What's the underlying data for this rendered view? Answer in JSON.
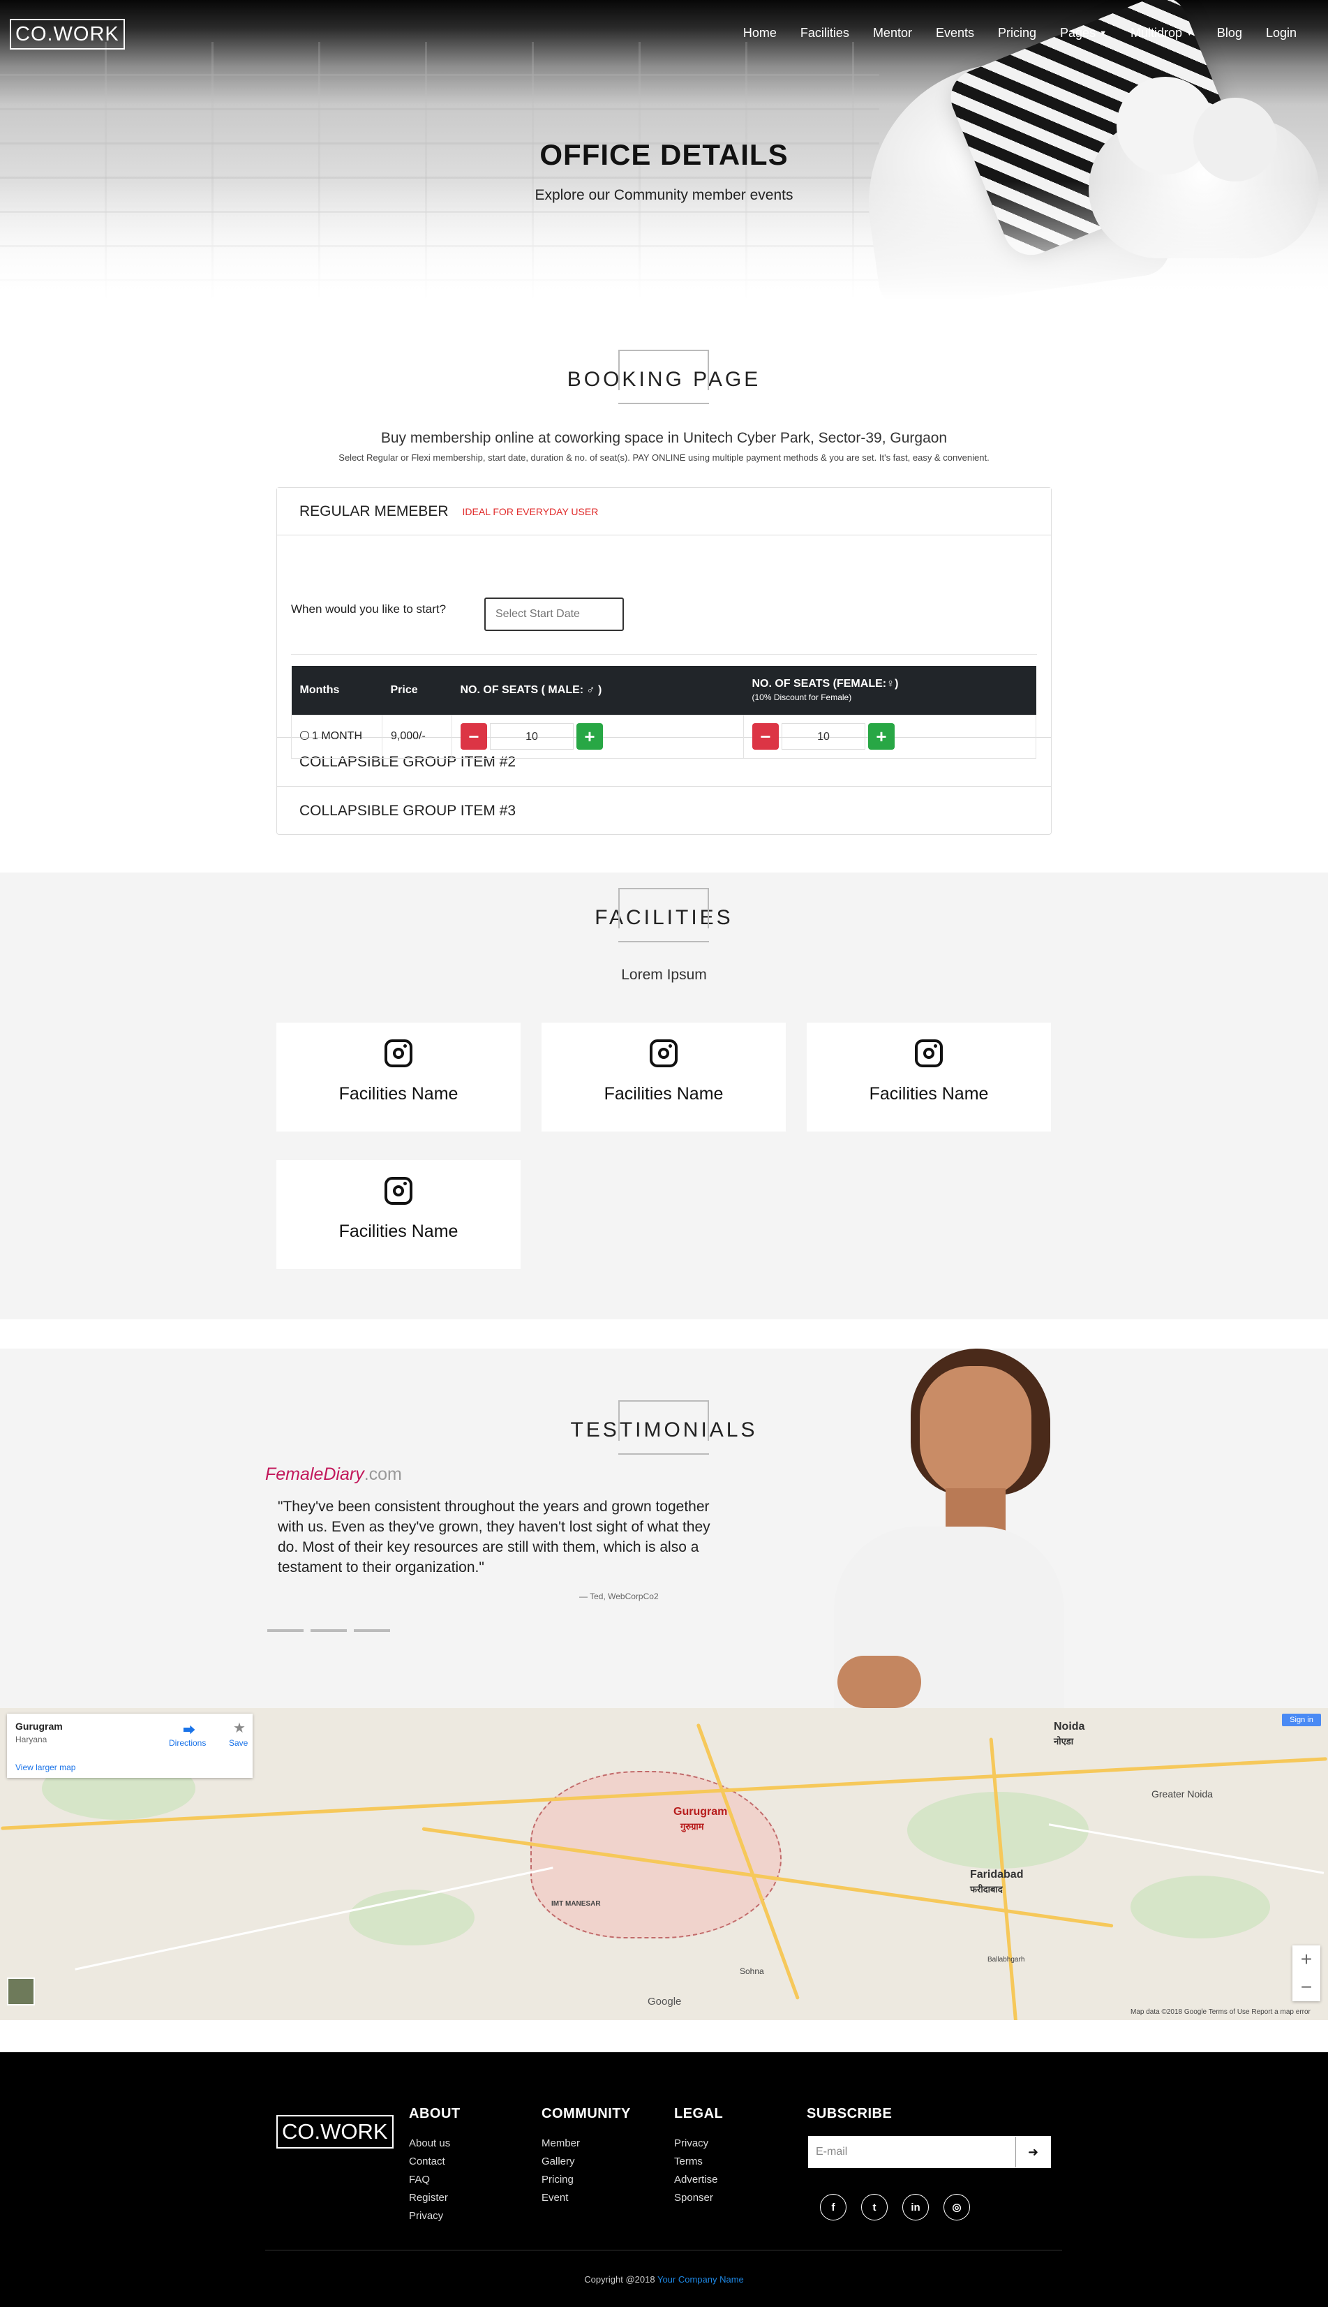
{
  "nav": {
    "logo": "CO.WORK",
    "items": [
      {
        "label": "Home"
      },
      {
        "label": "Facilities"
      },
      {
        "label": "Mentor"
      },
      {
        "label": "Events"
      },
      {
        "label": "Pricing"
      },
      {
        "label": "Pages",
        "dropdown": true
      },
      {
        "label": "Multidrop",
        "dropdown": true
      },
      {
        "label": "Blog"
      },
      {
        "label": "Login"
      }
    ]
  },
  "hero": {
    "title": "OFFICE DETAILS",
    "subtitle": "Explore our Community member events"
  },
  "booking": {
    "heading": "BOOKING PAGE",
    "subtitle": "Buy membership online at coworking space in Unitech Cyber Park, Sector-39, Gurgaon",
    "note": "Select Regular or Flexi membership, start date, duration & no. of seat(s). PAY ONLINE using multiple payment methods & you are set. It's fast, easy & convenient.",
    "panel_title": "REGULAR MEMEBER",
    "panel_tag": "IDEAL FOR EVERYDAY USER",
    "start_question": "When would you like to start?",
    "start_placeholder": "Select Start Date",
    "table": {
      "col_months": "Months",
      "col_price": "Price",
      "col_male": "NO. OF SEATS ( MALE: ♂ )",
      "col_female": "NO. OF SEATS (FEMALE:♀)",
      "col_female_note": "(10% Discount for Female)",
      "row_month": "1 MONTH",
      "row_price": "9,000/-",
      "male_count": "10",
      "female_count": "10"
    },
    "group2": "COLLAPSIBLE GROUP ITEM #2",
    "group3": "COLLAPSIBLE GROUP ITEM #3"
  },
  "facilities": {
    "heading": "FACILITIES",
    "subtitle": "Lorem Ipsum",
    "cards": [
      {
        "name": "Facilities Name",
        "icon": "instagram-icon"
      },
      {
        "name": "Facilities Name",
        "icon": "instagram-icon"
      },
      {
        "name": "Facilities Name",
        "icon": "instagram-icon"
      },
      {
        "name": "Facilities Name",
        "icon": "instagram-icon"
      }
    ]
  },
  "testimonials": {
    "heading": "TESTIMONIALS",
    "brand": "FemaleDiary",
    "brand_suffix": ".com",
    "quote": "\"They've been consistent throughout the years and grown together with us. Even as they've grown, they haven't lost sight of what they do. Most of their key resources are still with them, which is also a testament to their organization.\"",
    "cite": "— Ted, WebCorpCo2"
  },
  "map": {
    "place": "Gurugram",
    "region": "Haryana",
    "directions": "Directions",
    "save": "Save",
    "larger": "View larger map",
    "signin": "Sign in",
    "footer_text": "Map data ©2018 Google    Terms of Use    Report a map error",
    "google": "Google",
    "cities": {
      "gurugram": "Gurugram",
      "gurugram_hi": "गुरुग्राम",
      "noida": "Noida",
      "noida_hi": "नोएडा",
      "faridabad": "Faridabad",
      "faridabad_hi": "फरीदाबाद",
      "greater_noida": "Greater Noida",
      "manesar": "IMT MANESAR",
      "palwal": "Ballabhgarh",
      "sohna": "Sohna"
    }
  },
  "footer": {
    "logo": "CO.WORK",
    "about": {
      "title": "ABOUT",
      "links": [
        "About us",
        "Contact",
        "FAQ",
        "Register",
        "Privacy"
      ]
    },
    "community": {
      "title": "COMMUNITY",
      "links": [
        "Member",
        "Gallery",
        "Pricing",
        "Event"
      ]
    },
    "legal": {
      "title": "LEGAL",
      "links": [
        "Privacy",
        "Terms",
        "Advertise",
        "Sponser"
      ]
    },
    "subscribe": {
      "title": "SUBSCRIBE",
      "placeholder": "E-mail"
    },
    "social": [
      "facebook-icon",
      "twitter-icon",
      "linkedin-icon",
      "instagram-icon"
    ],
    "copyright": "Copyright @2018 ",
    "company": "Your Company Name"
  }
}
